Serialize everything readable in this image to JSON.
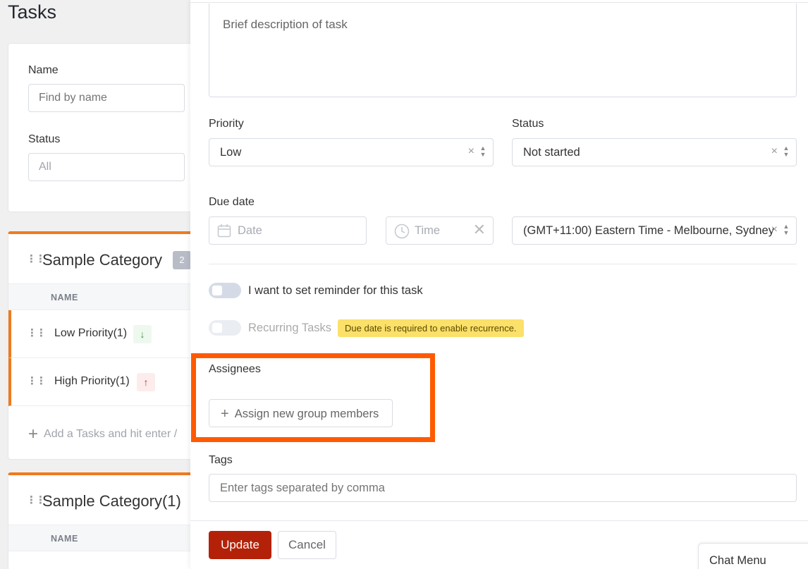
{
  "page": {
    "title": "Tasks"
  },
  "filters": {
    "name_label": "Name",
    "name_placeholder": "Find by name",
    "status_label": "Status",
    "status_value": "All"
  },
  "categories": [
    {
      "title": "Sample Category",
      "count": "2",
      "column_header": "NAME",
      "rows": [
        {
          "label": "Low Priority(1)",
          "priority_icon": "arrow-down-icon"
        },
        {
          "label": "High Priority(1)",
          "priority_icon": "arrow-up-icon"
        }
      ],
      "add_task_text": "Add a Tasks and hit enter /"
    },
    {
      "title": "Sample Category(1)",
      "column_header": "NAME"
    }
  ],
  "form": {
    "description_placeholder": "Brief description of task",
    "priority_label": "Priority",
    "priority_value": "Low",
    "status_label": "Status",
    "status_value": "Not started",
    "due_date_label": "Due date",
    "date_placeholder": "Date",
    "time_placeholder": "Time",
    "timezone_value": "(GMT+11:00) Eastern Time - Melbourne, Sydney",
    "reminder_label": "I want to set reminder for this task",
    "reminder_on": false,
    "recurring_label": "Recurring Tasks",
    "recurring_on": false,
    "recurring_warning": "Due date is required to enable recurrence.",
    "assignees_label": "Assignees",
    "assign_button": "Assign new group members",
    "tags_label": "Tags",
    "tags_placeholder": "Enter tags separated by comma",
    "update_button": "Update",
    "cancel_button": "Cancel"
  },
  "chat": {
    "label": "Chat Menu"
  },
  "colors": {
    "accent": "#f07a1e",
    "primary_button": "#b32208",
    "highlight": "#ff5a00",
    "warning_badge": "#fbe069"
  }
}
